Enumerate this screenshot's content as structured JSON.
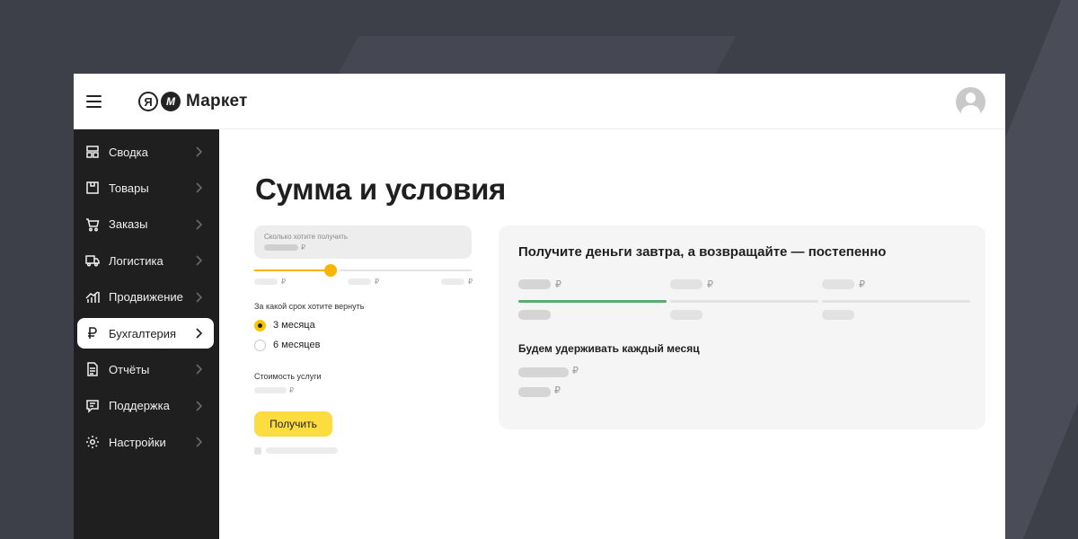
{
  "app": {
    "logo": {
      "ya": "Я",
      "m": "M",
      "text": "Маркет"
    }
  },
  "sidebar": {
    "items": [
      {
        "label": "Сводка",
        "icon": "dashboard-icon",
        "has_chevron": false
      },
      {
        "label": "Товары",
        "icon": "box-icon",
        "has_chevron": true
      },
      {
        "label": "Заказы",
        "icon": "cart-icon",
        "has_chevron": true
      },
      {
        "label": "Логистика",
        "icon": "truck-icon",
        "has_chevron": true
      },
      {
        "label": "Продвижение",
        "icon": "chart-icon",
        "has_chevron": true
      },
      {
        "label": "Бухгалтерия",
        "icon": "ruble-icon",
        "has_chevron": true,
        "active": true
      },
      {
        "label": "Отчёты",
        "icon": "document-icon",
        "has_chevron": true
      },
      {
        "label": "Поддержка",
        "icon": "chat-icon",
        "has_chevron": false
      },
      {
        "label": "Настройки",
        "icon": "gear-icon",
        "has_chevron": true
      }
    ]
  },
  "main": {
    "title": "Сумма и условия",
    "amount_field": {
      "label": "Сколько хотите получить",
      "currency": "₽"
    },
    "slider": {
      "level_fraction": 0.35
    },
    "tick_currency": "₽",
    "period": {
      "label": "За какой срок хотите вернуть",
      "options": [
        {
          "label": "3 месяца",
          "checked": true
        },
        {
          "label": "6 месяцев",
          "checked": false
        }
      ]
    },
    "cost": {
      "label": "Стоимость услуги",
      "currency": "₽"
    },
    "submit_label": "Получить",
    "card": {
      "title": "Получите деньги завтра, а возвращайте — постепенно",
      "currency": "₽",
      "hold_title": "Будем удерживать каждый месяц"
    }
  },
  "colors": {
    "accent_yellow": "#fddc3f",
    "slider_orange": "#f7b500",
    "progress_green": "#5bab6a",
    "sidebar_bg": "#1f1f1f"
  }
}
